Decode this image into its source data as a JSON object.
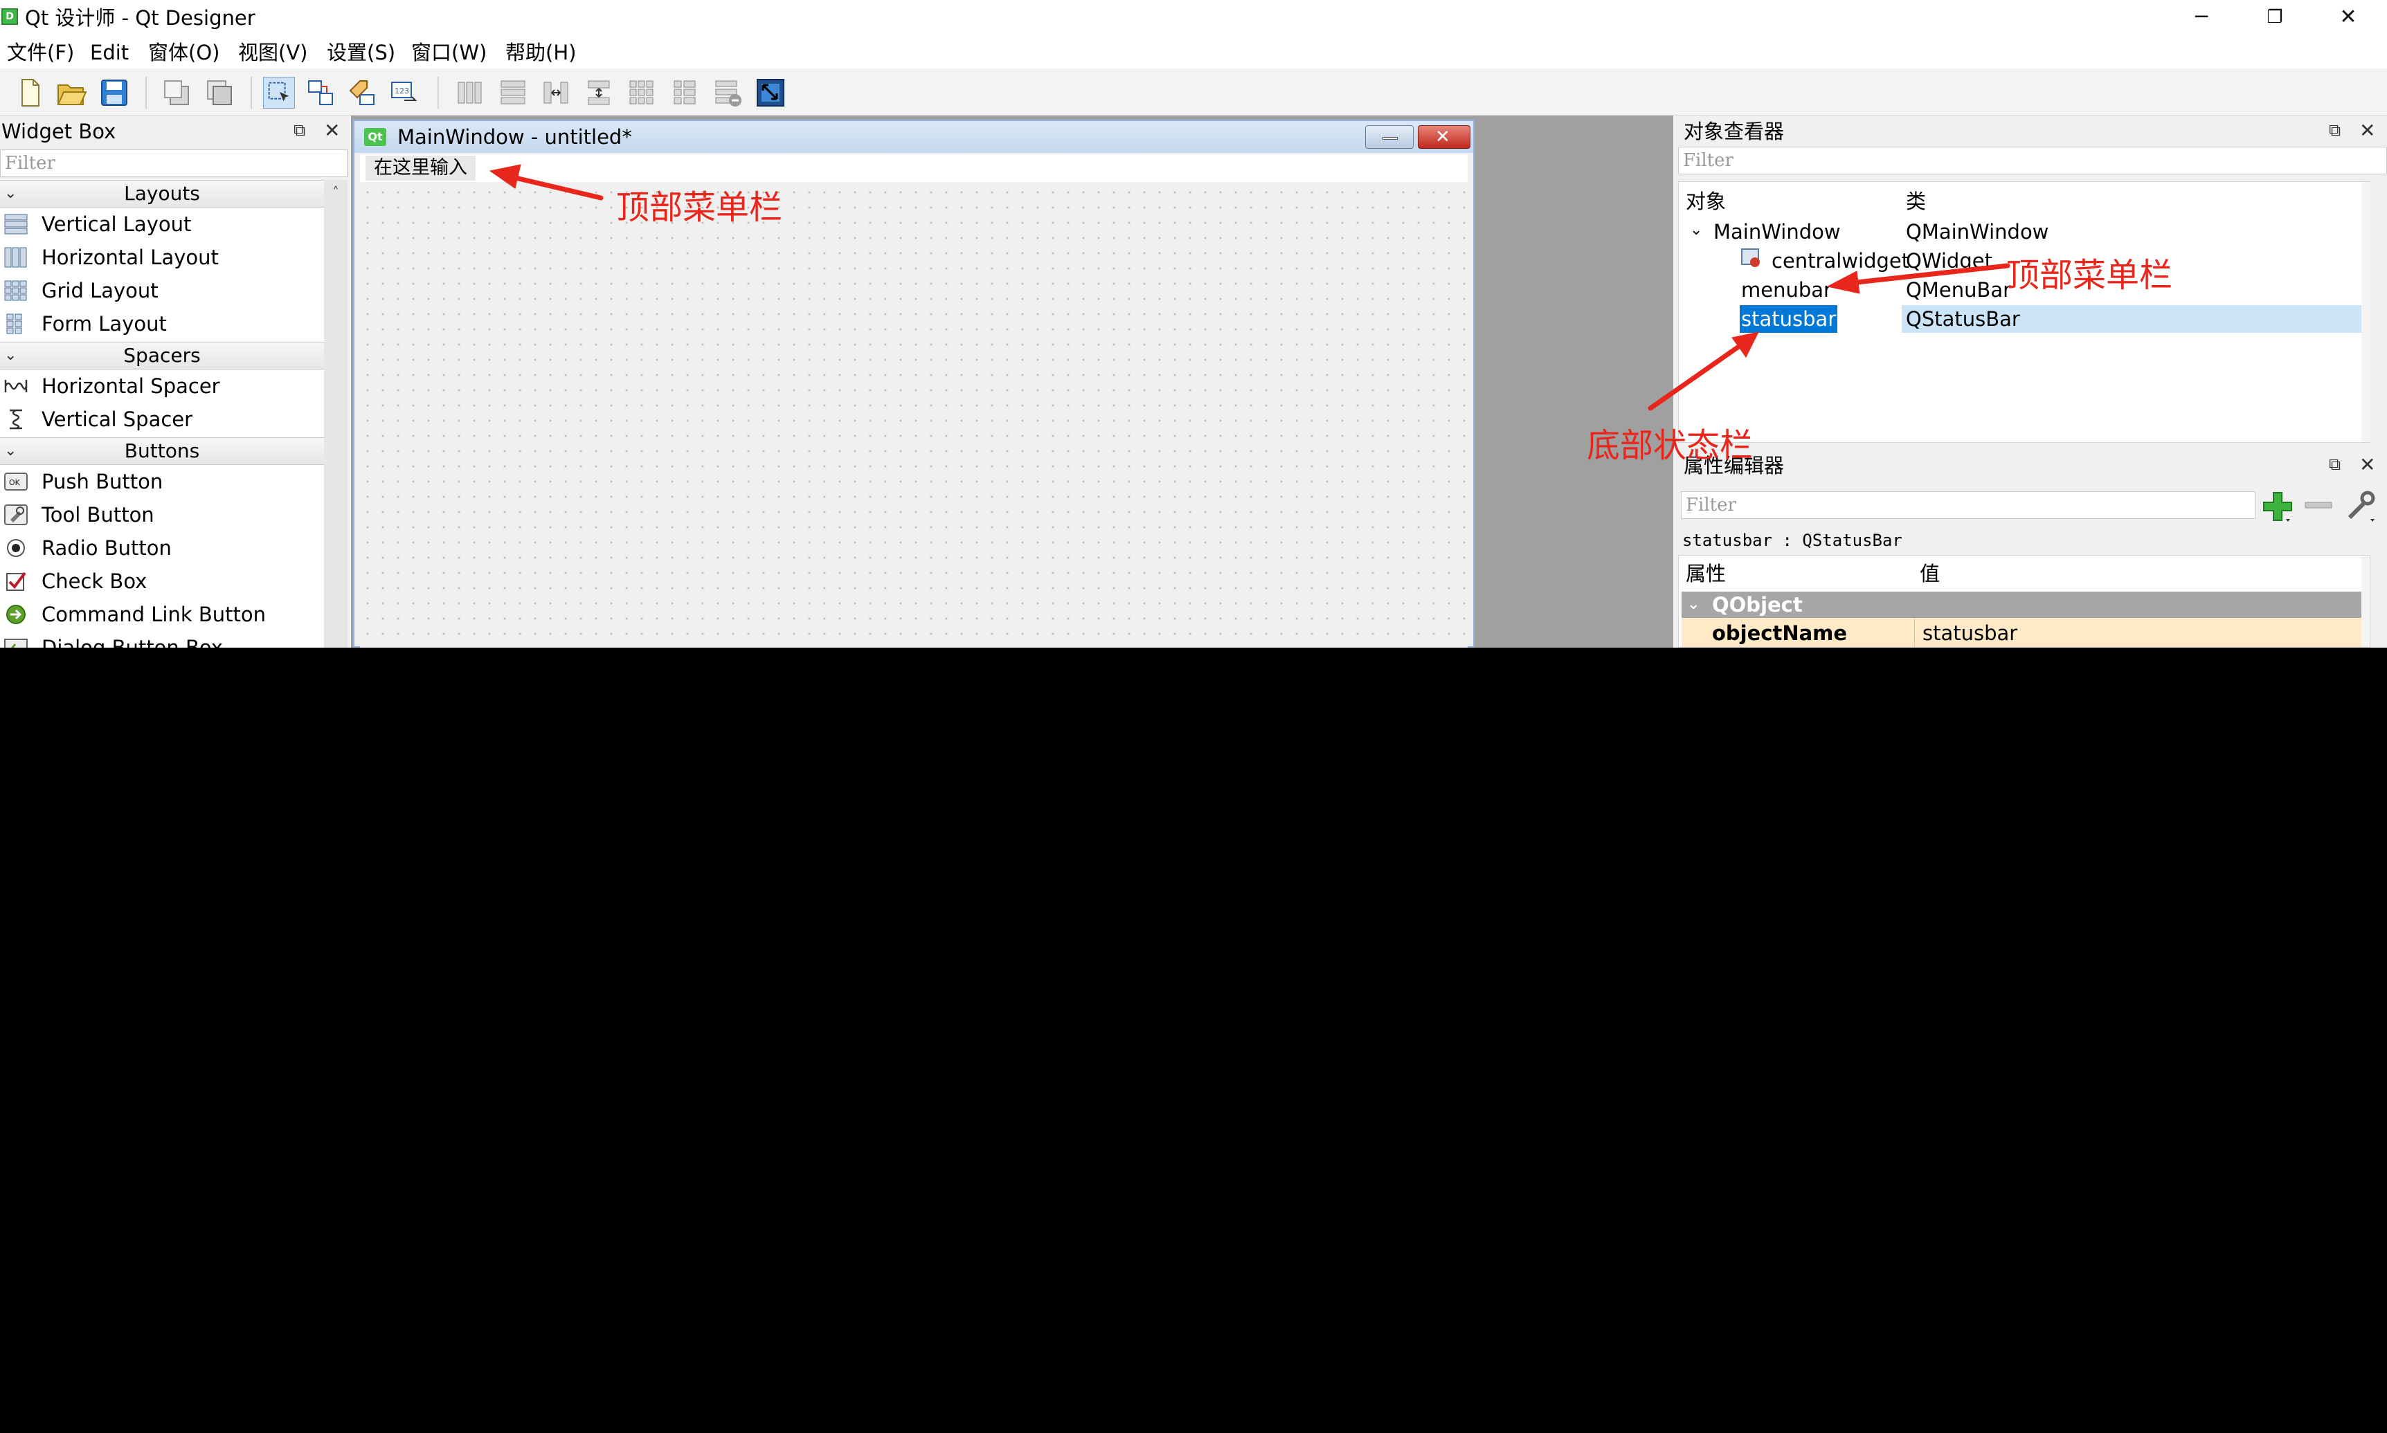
{
  "window": {
    "title": "Qt 设计师 - Qt Designer",
    "app_icon_letter": "D",
    "minimize_glyph": "─",
    "maximize_glyph": "❐",
    "close_glyph": "✕"
  },
  "menubar": {
    "items": [
      "文件(F)",
      "Edit",
      "窗体(O)",
      "视图(V)",
      "设置(S)",
      "窗口(W)",
      "帮助(H)"
    ]
  },
  "toolbar": {
    "icons": [
      "new-file-icon",
      "open-folder-icon",
      "save-icon",
      "send-to-back-icon",
      "bring-to-front-icon",
      "edit-widgets-icon",
      "edit-signals-slots-icon",
      "edit-buddies-icon",
      "edit-tab-order-icon",
      "layout-horizontal-icon",
      "layout-vertical-icon",
      "layout-horizontal-splitter-icon",
      "layout-vertical-splitter-icon",
      "layout-grid-icon",
      "layout-form-icon",
      "break-layout-icon",
      "adjust-size-icon"
    ]
  },
  "widget_box": {
    "title": "Widget Box",
    "filter_placeholder": "Filter",
    "categories": [
      {
        "label": "Layouts",
        "items": [
          "Vertical Layout",
          "Horizontal Layout",
          "Grid Layout",
          "Form Layout"
        ]
      },
      {
        "label": "Spacers",
        "items": [
          "Horizontal Spacer",
          "Vertical Spacer"
        ]
      },
      {
        "label": "Buttons",
        "items": [
          "Push Button",
          "Tool Button",
          "Radio Button",
          "Check Box",
          "Command Link Button",
          "Dialog Button Box"
        ]
      }
    ]
  },
  "form_window": {
    "title": "MainWindow - untitled*",
    "qt_badge": "Qt",
    "menu_placeholder": "在这里输入"
  },
  "object_inspector": {
    "title": "对象查看器",
    "filter_placeholder": "Filter",
    "col_object": "对象",
    "col_class": "类",
    "rows": [
      {
        "name": "MainWindow",
        "class": "QMainWindow"
      },
      {
        "name": "centralwidget",
        "class": "QWidget"
      },
      {
        "name": "menubar",
        "class": "QMenuBar"
      },
      {
        "name": "statusbar",
        "class": "QStatusBar"
      }
    ]
  },
  "property_editor": {
    "title": "属性编辑器",
    "filter_placeholder": "Filter",
    "context": "statusbar : QStatusBar",
    "col_property": "属性",
    "col_value": "值",
    "group": "QObject",
    "row_name": "objectName",
    "row_value": "statusbar"
  },
  "annotations": {
    "top_menu_form": "顶部菜单栏",
    "top_menu_inspector": "顶部菜单栏",
    "bottom_status": "底部状态栏"
  },
  "colors": {
    "annotation": "#e8261b",
    "selection": "#0078d7",
    "selection_light": "#cce4f7"
  }
}
